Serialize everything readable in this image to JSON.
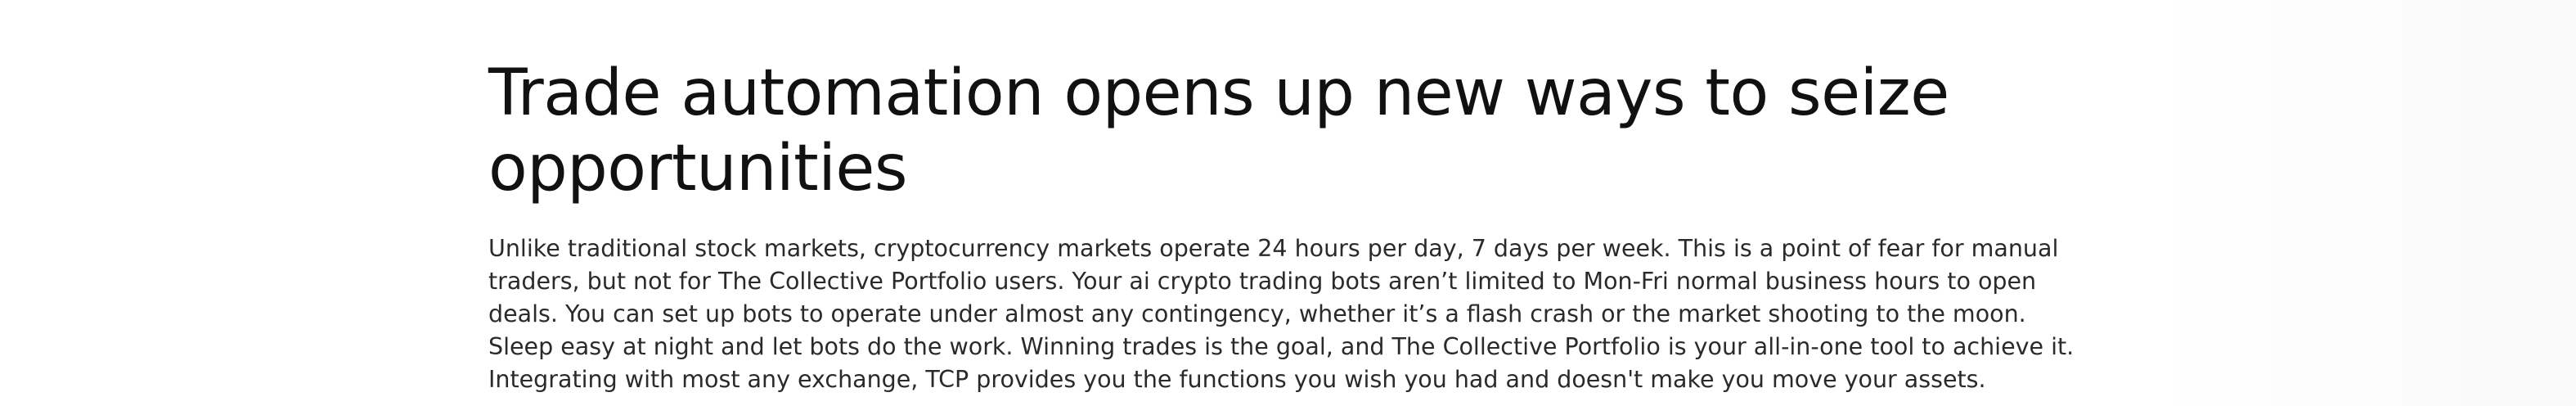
{
  "section": {
    "heading": "Trade automation opens up new ways to seize opportunities",
    "paragraph": "Unlike traditional stock markets, cryptocurrency markets operate 24 hours per day, 7 days per week. This is a point of fear for manual traders, but not for The Collective Portfolio users. Your ai crypto trading bots aren’t limited to Mon-Fri normal business hours to open deals. You can set up bots to operate under almost any contingency, whether it’s a flash crash or the market shooting to the moon. Sleep easy at night and let bots do the work. Winning trades is the goal, and The Collective Portfolio is your all-in-one tool to achieve it. Integrating with most any exchange, TCP provides you the functions you wish you had and doesn't make you move your assets."
  },
  "colors": {
    "background": "#ffffff",
    "heading_text": "#111111",
    "body_text": "#2a2a2a"
  }
}
